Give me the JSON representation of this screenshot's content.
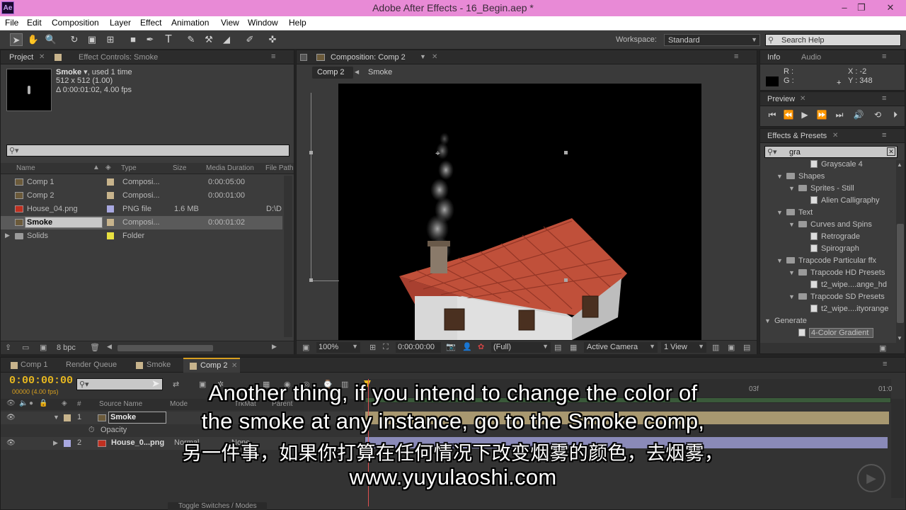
{
  "window": {
    "title": "Adobe After Effects - 16_Begin.aep *",
    "logo": "Ae"
  },
  "menu": [
    "File",
    "Edit",
    "Composition",
    "Layer",
    "Effect",
    "Animation",
    "View",
    "Window",
    "Help"
  ],
  "toolbar": {
    "workspace_label": "Workspace:",
    "workspace_value": "Standard",
    "search_placeholder": "Search Help"
  },
  "project": {
    "tab_project": "Project",
    "tab_effect_controls": "Effect Controls: Smoke",
    "item_name": "Smoke",
    "item_used": ", used 1 time",
    "item_size": "512 x 512 (1.00)",
    "item_duration": "Δ 0:00:01:02, 4.00 fps",
    "columns": {
      "name": "Name",
      "type": "Type",
      "size": "Size",
      "duration": "Media Duration",
      "path": "File Path"
    },
    "rows": [
      {
        "name": "Comp 1",
        "type": "Composi...",
        "size": "",
        "duration": "0:00:05:00",
        "path": ""
      },
      {
        "name": "Comp 2",
        "type": "Composi...",
        "size": "",
        "duration": "0:00:01:00",
        "path": ""
      },
      {
        "name": "House_04.png",
        "type": "PNG file",
        "size": "1.6 MB",
        "duration": "",
        "path": "D:\\D"
      },
      {
        "name": "Smoke",
        "type": "Composi...",
        "size": "",
        "duration": "0:00:01:02",
        "path": ""
      },
      {
        "name": "Solids",
        "type": "Folder",
        "size": "",
        "duration": "",
        "path": ""
      }
    ],
    "bpc": "8 bpc"
  },
  "composition": {
    "tab": "Composition: Comp 2",
    "crumb_active": "Comp 2",
    "crumb_next": "Smoke",
    "zoom": "100%",
    "timecode": "0:00:00:00",
    "resolution": "(Full)",
    "camera": "Active Camera",
    "view": "1 View"
  },
  "info": {
    "tab_info": "Info",
    "tab_audio": "Audio",
    "r": "R :",
    "g": "G :",
    "x": "X : -2",
    "y": "Y : 348"
  },
  "preview": {
    "tab": "Preview"
  },
  "effects": {
    "tab": "Effects & Presets",
    "search": "gra",
    "items": [
      {
        "label": "Grayscale 4",
        "depth": 3,
        "kind": "preset",
        "tri": ""
      },
      {
        "label": "Shapes",
        "depth": 1,
        "kind": "folder",
        "tri": "▼"
      },
      {
        "label": "Sprites - Still",
        "depth": 2,
        "kind": "folder",
        "tri": "▼"
      },
      {
        "label": "Alien Calligraphy",
        "depth": 3,
        "kind": "preset",
        "tri": ""
      },
      {
        "label": "Text",
        "depth": 1,
        "kind": "folder",
        "tri": "▼"
      },
      {
        "label": "Curves and Spins",
        "depth": 2,
        "kind": "folder",
        "tri": "▼"
      },
      {
        "label": "Retrograde",
        "depth": 3,
        "kind": "preset",
        "tri": ""
      },
      {
        "label": "Spirograph",
        "depth": 3,
        "kind": "preset",
        "tri": ""
      },
      {
        "label": "Trapcode Particular ffx",
        "depth": 1,
        "kind": "folder",
        "tri": "▼"
      },
      {
        "label": "Trapcode HD Presets",
        "depth": 2,
        "kind": "folder",
        "tri": "▼"
      },
      {
        "label": "t2_wipe....ange_hd",
        "depth": 3,
        "kind": "preset",
        "tri": ""
      },
      {
        "label": "Trapcode SD Presets",
        "depth": 2,
        "kind": "folder",
        "tri": "▼"
      },
      {
        "label": "t2_wipe....ityorange",
        "depth": 3,
        "kind": "preset",
        "tri": ""
      },
      {
        "label": "Generate",
        "depth": 0,
        "kind": "none",
        "tri": "▼"
      },
      {
        "label": "4-Color Gradient",
        "depth": 2,
        "kind": "preset",
        "tri": ""
      }
    ]
  },
  "timeline": {
    "tabs": [
      "Comp 1",
      "Render Queue",
      "Smoke",
      "Comp 2"
    ],
    "timecode": "0:00:00:00",
    "fps": "00000 (4.00 fps)",
    "col_source": "Source Name",
    "col_mode": "Mode",
    "col_trkmat": "TrkMat",
    "col_parent": "Parent",
    "col_num": "#",
    "ruler": [
      "03f",
      "01:0"
    ],
    "layers": [
      {
        "num": "1",
        "name": "Smoke"
      },
      {
        "num": "2",
        "name": "House_0...png",
        "mode": "Normal",
        "trk": "None"
      }
    ],
    "property": "Opacity",
    "toggle": "Toggle Switches / Modes"
  },
  "subtitles": [
    "Another thing, if you intend to change the color of",
    "the smoke at any instance, go to the Smoke comp,",
    "另一件事，如果你打算在任何情况下改变烟雾的颜色，去烟雾，",
    "www.yuyulaoshi.com"
  ]
}
